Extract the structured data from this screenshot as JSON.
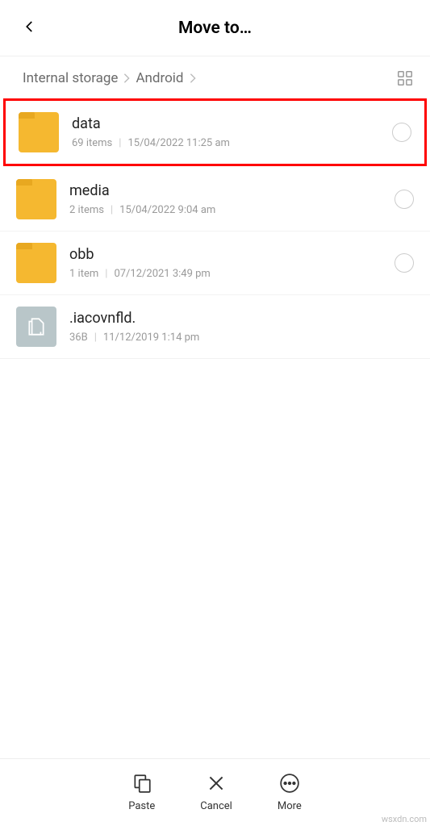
{
  "header": {
    "title": "Move to…"
  },
  "breadcrumb": {
    "parts": [
      "Internal storage",
      "Android"
    ]
  },
  "items": [
    {
      "name": "data",
      "count": "69 items",
      "date": "15/04/2022 11:25 am",
      "type": "folder",
      "selectable": true,
      "highlighted": true
    },
    {
      "name": "media",
      "count": "2 items",
      "date": "15/04/2022 9:04 am",
      "type": "folder",
      "selectable": true,
      "highlighted": false
    },
    {
      "name": "obb",
      "count": "1 item",
      "date": "07/12/2021 3:49 pm",
      "type": "folder",
      "selectable": true,
      "highlighted": false
    },
    {
      "name": ".iacovnfld.",
      "count": "36B",
      "date": "11/12/2019 1:14 pm",
      "type": "file",
      "selectable": false,
      "highlighted": false
    }
  ],
  "toolbar": {
    "paste": "Paste",
    "cancel": "Cancel",
    "more": "More"
  },
  "watermark": "wsxdn.com"
}
